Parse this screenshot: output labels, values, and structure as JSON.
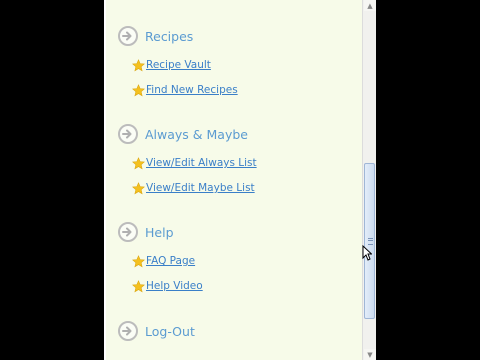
{
  "menu": {
    "sections": [
      {
        "title": "Recipes",
        "icon": "arrow-right-icon",
        "links": [
          {
            "label": "Recipe Vault",
            "icon": "star-icon"
          },
          {
            "label": "Find New Recipes",
            "icon": "star-icon"
          }
        ]
      },
      {
        "title": "Always & Maybe",
        "icon": "arrow-right-icon",
        "links": [
          {
            "label": "View/Edit Always List",
            "icon": "star-icon"
          },
          {
            "label": "View/Edit Maybe List",
            "icon": "star-icon"
          }
        ]
      },
      {
        "title": "Help",
        "icon": "arrow-right-icon",
        "links": [
          {
            "label": "FAQ Page",
            "icon": "star-icon"
          },
          {
            "label": "Help Video",
            "icon": "star-icon"
          }
        ]
      },
      {
        "title": "Log-Out",
        "icon": "arrow-right-icon",
        "links": []
      }
    ]
  },
  "scrollbar": {
    "position_fraction": 0.45,
    "visible_fraction": 0.45
  },
  "colors": {
    "background": "#f7fbe9",
    "section_title": "#5b9bd1",
    "link": "#3a7fc8",
    "star": "#f4c01e",
    "outer": "#000000"
  }
}
